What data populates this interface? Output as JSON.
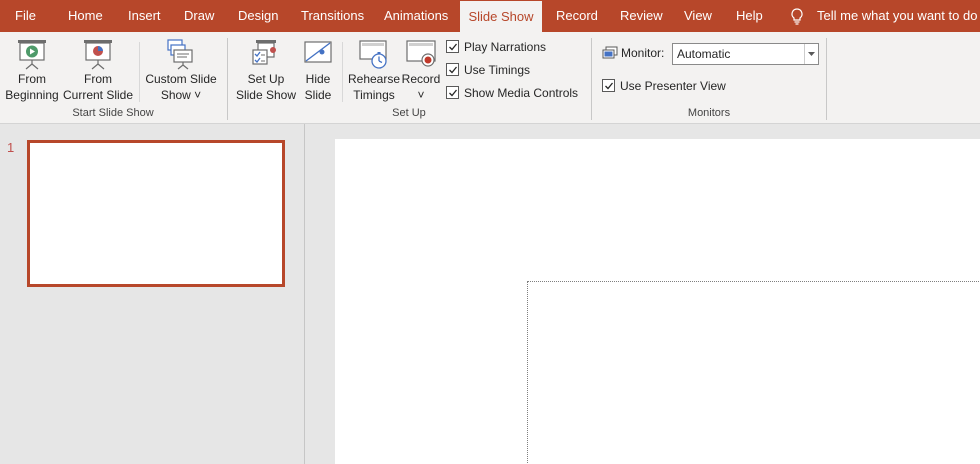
{
  "tabs": [
    {
      "label": "File"
    },
    {
      "label": "Home"
    },
    {
      "label": "Insert"
    },
    {
      "label": "Draw"
    },
    {
      "label": "Design"
    },
    {
      "label": "Transitions"
    },
    {
      "label": "Animations"
    },
    {
      "label": "Slide Show",
      "active": true
    },
    {
      "label": "Record"
    },
    {
      "label": "Review"
    },
    {
      "label": "View"
    },
    {
      "label": "Help"
    }
  ],
  "tell_me": "Tell me what you want to do",
  "start_group": {
    "label": "Start Slide Show",
    "from_beginning": [
      "From",
      "Beginning"
    ],
    "from_current": [
      "From",
      "Current Slide"
    ],
    "custom_show": [
      "Custom Slide",
      "Show ˅"
    ]
  },
  "setup_group": {
    "label": "Set Up",
    "setup_show": [
      "Set Up",
      "Slide Show"
    ],
    "hide_slide": [
      "Hide",
      "Slide"
    ],
    "rehearse": [
      "Rehearse",
      "Timings"
    ],
    "record": [
      "Record",
      "˅"
    ],
    "checks": [
      {
        "label": "Play Narrations",
        "checked": true
      },
      {
        "label": "Use Timings",
        "checked": true
      },
      {
        "label": "Show Media Controls",
        "checked": true
      }
    ]
  },
  "monitors_group": {
    "label": "Monitors",
    "monitor_label": "Monitor:",
    "monitor_value": "Automatic",
    "presenter_view": {
      "label": "Use Presenter View",
      "checked": true
    }
  },
  "slides": [
    {
      "number": "1"
    }
  ],
  "colors": {
    "accent": "#b7472a",
    "ribbon": "#f3f2f1",
    "workspace": "#e6e6e6"
  }
}
